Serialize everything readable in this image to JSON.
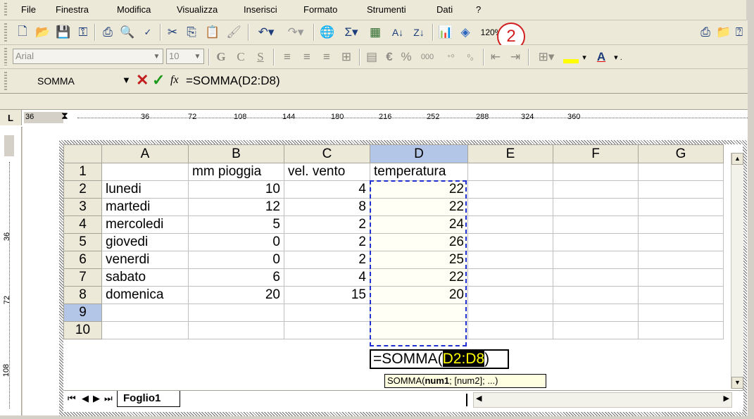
{
  "menu": [
    "File",
    "Finestra",
    "Modifica",
    "Visualizza",
    "Inserisci",
    "Formato",
    "Strumenti",
    "Dati",
    "?"
  ],
  "toolbar": {
    "zoom": "120%",
    "annotation": "2"
  },
  "format": {
    "font": "Arial",
    "size": "10",
    "bold": "G",
    "italic": "C",
    "underline": "S",
    "euro": "€",
    "percent": "%",
    "thousands": "000"
  },
  "formula_bar": {
    "name_box": "SOMMA",
    "fx": "fx",
    "formula": "=SOMMA(D2:D8)"
  },
  "ruler": {
    "marks": [
      "36",
      "36",
      "72",
      "108",
      "144",
      "180",
      "216",
      "252",
      "288",
      "324",
      "360"
    ],
    "vmarks": [
      "36",
      "72",
      "108"
    ]
  },
  "sheet": {
    "columns": [
      "A",
      "B",
      "C",
      "D",
      "E",
      "F",
      "G"
    ],
    "rows": [
      {
        "n": "1",
        "a": "",
        "b": "mm pioggia",
        "c": "vel. vento",
        "d": "temperatura"
      },
      {
        "n": "2",
        "a": "lunedi",
        "b": "10",
        "c": "4",
        "d": "22"
      },
      {
        "n": "3",
        "a": "martedi",
        "b": "12",
        "c": "8",
        "d": "22"
      },
      {
        "n": "4",
        "a": "mercoledi",
        "b": "5",
        "c": "2",
        "d": "24"
      },
      {
        "n": "5",
        "a": "giovedi",
        "b": "0",
        "c": "2",
        "d": "26"
      },
      {
        "n": "6",
        "a": "venerdi",
        "b": "0",
        "c": "2",
        "d": "25"
      },
      {
        "n": "7",
        "a": "sabato",
        "b": "6",
        "c": "4",
        "d": "22"
      },
      {
        "n": "8",
        "a": "domenica",
        "b": "20",
        "c": "15",
        "d": "20"
      },
      {
        "n": "9",
        "a": "",
        "b": "",
        "c": "",
        "d": ""
      },
      {
        "n": "10",
        "a": "",
        "b": "",
        "c": "",
        "d": ""
      }
    ],
    "edit_prefix": "=SOMMA(",
    "edit_ref": "D2:D8",
    "edit_suffix": ")",
    "tooltip_fn": "SOMMA(",
    "tooltip_arg1": "num1",
    "tooltip_rest": "; [num2]; ...)",
    "tab": "Foglio1"
  }
}
